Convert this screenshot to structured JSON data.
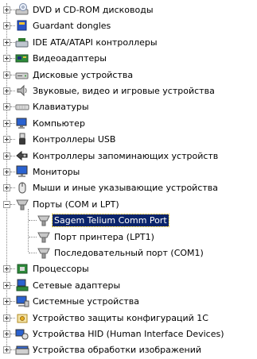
{
  "tree": {
    "nodes": [
      {
        "label": "DVD и CD-ROM дисководы",
        "icon": "dvd-drive-icon",
        "expander": "plus",
        "level": 0
      },
      {
        "label": "Guardant dongles",
        "icon": "dongle-icon",
        "expander": "plus",
        "level": 0
      },
      {
        "label": "IDE ATA/ATAPI контроллеры",
        "icon": "ide-controller-icon",
        "expander": "plus",
        "level": 0
      },
      {
        "label": "Видеоадаптеры",
        "icon": "display-adapter-icon",
        "expander": "plus",
        "level": 0
      },
      {
        "label": "Дисковые устройства",
        "icon": "disk-drive-icon",
        "expander": "plus",
        "level": 0
      },
      {
        "label": "Звуковые, видео и игровые устройства",
        "icon": "speaker-icon",
        "expander": "plus",
        "level": 0
      },
      {
        "label": "Клавиатуры",
        "icon": "keyboard-icon",
        "expander": "plus",
        "level": 0
      },
      {
        "label": "Компьютер",
        "icon": "computer-icon",
        "expander": "plus",
        "level": 0
      },
      {
        "label": "Контроллеры USB",
        "icon": "usb-icon",
        "expander": "plus",
        "level": 0
      },
      {
        "label": "Контроллеры запоминающих устройств",
        "icon": "storage-controller-icon",
        "expander": "plus",
        "level": 0
      },
      {
        "label": "Мониторы",
        "icon": "monitor-icon",
        "expander": "plus",
        "level": 0
      },
      {
        "label": "Мыши и иные указывающие устройства",
        "icon": "mouse-icon",
        "expander": "plus",
        "level": 0
      },
      {
        "label": "Порты (COM и LPT)",
        "icon": "port-icon",
        "expander": "minus",
        "level": 0
      },
      {
        "label": "Sagem Telium Comm Port",
        "icon": "port-icon",
        "expander": "none",
        "level": 1,
        "selected": true
      },
      {
        "label": "Порт принтера (LPT1)",
        "icon": "port-icon",
        "expander": "none",
        "level": 1
      },
      {
        "label": "Последовательный порт (COM1)",
        "icon": "port-icon",
        "expander": "none",
        "level": 1
      },
      {
        "label": "Процессоры",
        "icon": "processor-icon",
        "expander": "plus",
        "level": 0
      },
      {
        "label": "Сетевые адаптеры",
        "icon": "network-adapter-icon",
        "expander": "plus",
        "level": 0
      },
      {
        "label": "Системные устройства",
        "icon": "system-device-icon",
        "expander": "plus",
        "level": 0
      },
      {
        "label": "Устройство защиты конфигураций 1С",
        "icon": "protection-device-icon",
        "expander": "plus",
        "level": 0
      },
      {
        "label": "Устройства HID (Human Interface Devices)",
        "icon": "hid-icon",
        "expander": "plus",
        "level": 0
      },
      {
        "label": "Устройства обработки изображений",
        "icon": "imaging-device-icon",
        "expander": "plus",
        "level": 0
      }
    ]
  },
  "colors": {
    "selection_bg": "#0a246a",
    "selection_text": "#ffffff",
    "tree_lines": "#8a8a8a"
  }
}
